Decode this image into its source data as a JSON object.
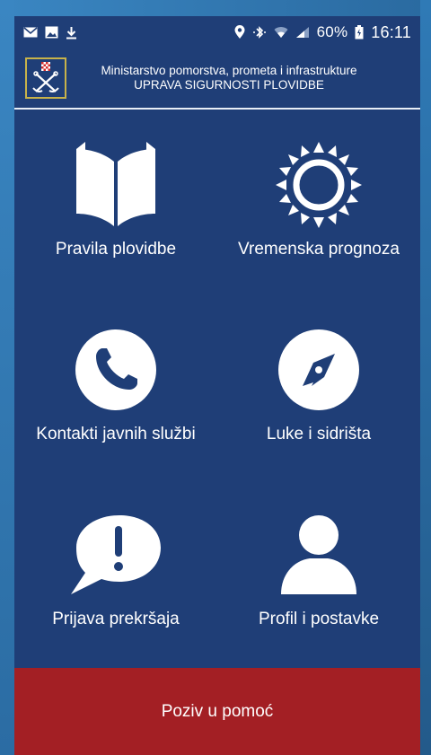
{
  "status_bar": {
    "battery": "60%",
    "time": "16:11",
    "icons": [
      "mail-icon",
      "image-icon",
      "download-icon",
      "location-icon",
      "bluetooth-icon",
      "wifi-icon",
      "signal-icon",
      "battery-icon"
    ]
  },
  "header": {
    "line1": "Ministarstvo pomorstva, prometa i infrastrukture",
    "line2": "UPRAVA SIGURNOSTI PLOVIDBE"
  },
  "tiles": [
    {
      "label": "Pravila plovidbe",
      "icon": "book-icon"
    },
    {
      "label": "Vremenska prognoza",
      "icon": "sun-icon"
    },
    {
      "label": "Kontakti javnih službi",
      "icon": "phone-icon"
    },
    {
      "label": "Luke i sidrišta",
      "icon": "compass-icon"
    },
    {
      "label": "Prijava prekršaja",
      "icon": "alert-bubble-icon"
    },
    {
      "label": "Profil i postavke",
      "icon": "user-icon"
    }
  ],
  "sos": {
    "label": "Poziv u pomoć"
  },
  "colors": {
    "background": "#1f3e77",
    "sos": "#a31f24",
    "text": "#ffffff"
  }
}
